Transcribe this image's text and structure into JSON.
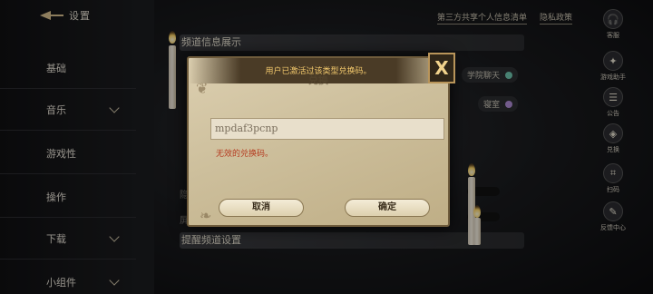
{
  "sidebar": {
    "back_label": "设置",
    "items": [
      {
        "label": "基础",
        "chevron": false
      },
      {
        "label": "音乐",
        "chevron": true
      },
      {
        "label": "游戏性",
        "chevron": false
      },
      {
        "label": "操作",
        "chevron": false
      },
      {
        "label": "下载",
        "chevron": true
      },
      {
        "label": "小组件",
        "chevron": true
      }
    ]
  },
  "top_links": {
    "third_party": "第三方共享个人信息清单",
    "privacy": "隐私政策"
  },
  "content": {
    "section_channel": "频道信息展示",
    "chat_label_1": "学院聊天",
    "chat_label_2": "寝室",
    "section_reminder": "提醒频道设置",
    "dim_row_1": "隐",
    "dim_row_2": "屏"
  },
  "right_bar": [
    {
      "icon": "headset-icon",
      "glyph": "🎧",
      "label": "客服"
    },
    {
      "icon": "game-assistant-icon",
      "glyph": "✦",
      "label": "游戏助手"
    },
    {
      "icon": "announcement-icon",
      "glyph": "☰",
      "label": "公告"
    },
    {
      "icon": "redeem-icon",
      "glyph": "◈",
      "label": "兑换"
    },
    {
      "icon": "scan-icon",
      "glyph": "⌗",
      "label": "扫码"
    },
    {
      "icon": "feedback-icon",
      "glyph": "✎",
      "label": "反馈中心"
    }
  ],
  "dialog": {
    "toast": "用户已激活过该类型兑换码。",
    "title": "兑换",
    "input_value": "mpdaf3pcnp",
    "error": "无效的兑换码。",
    "cancel_label": "取消",
    "ok_label": "确定",
    "close_glyph": "X"
  },
  "colors": {
    "accent_gold": "#f2c86c",
    "error_red": "#b53a1f",
    "parchment": "#d6c8a8",
    "teal_dot": "#6fc7b0",
    "purple_dot": "#b08cd6"
  }
}
